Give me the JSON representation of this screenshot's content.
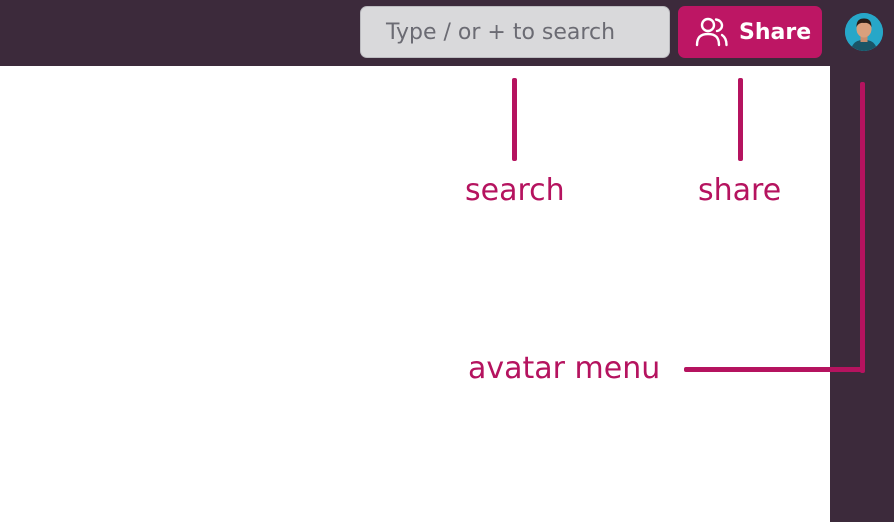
{
  "topbar": {
    "search": {
      "placeholder": "Type / or + to search"
    },
    "share": {
      "label": "Share",
      "icon": "people-icon"
    },
    "avatar": {
      "icon": "user-avatar"
    }
  },
  "annotations": {
    "search": "search",
    "share": "share",
    "avatar_menu": "avatar menu"
  },
  "colors": {
    "topbar_bg": "#3c2a3b",
    "accent": "#bd1664",
    "search_bg": "#d9d9db",
    "callout": "#b5135f"
  }
}
